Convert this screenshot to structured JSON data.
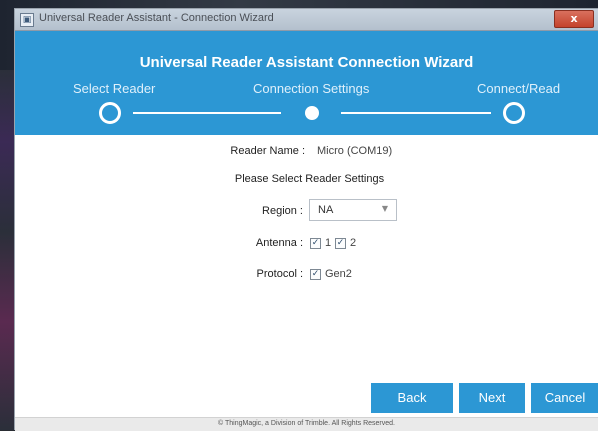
{
  "window": {
    "title": "Universal Reader Assistant - Connection Wizard",
    "close_symbol": "x"
  },
  "header": {
    "title": "Universal Reader Assistant Connection Wizard",
    "steps": [
      {
        "label": "Select Reader",
        "state": "pending"
      },
      {
        "label": "Connection Settings",
        "state": "current"
      },
      {
        "label": "Connect/Read",
        "state": "pending"
      }
    ]
  },
  "form": {
    "reader_name_label": "Reader Name :",
    "reader_name_value": "Micro (COM19)",
    "settings_heading": "Please Select Reader Settings",
    "region_label": "Region :",
    "region_value": "NA",
    "antenna_label": "Antenna :",
    "antennas": [
      {
        "label": "1",
        "checked": true
      },
      {
        "label": "2",
        "checked": true
      }
    ],
    "protocol_label": "Protocol :",
    "protocol": {
      "label": "Gen2",
      "checked": true
    },
    "checkmark": "✓"
  },
  "buttons": {
    "back": "Back",
    "next": "Next",
    "cancel": "Cancel"
  },
  "footer": {
    "text": "© ThingMagic, a Division of Trimble. All Rights Reserved."
  },
  "colors": {
    "accent": "#2c97d4",
    "close_button": "#c4432c"
  },
  "icons": {
    "app": "app-icon",
    "close": "close-icon",
    "dropdown": "chevron-down-icon"
  }
}
